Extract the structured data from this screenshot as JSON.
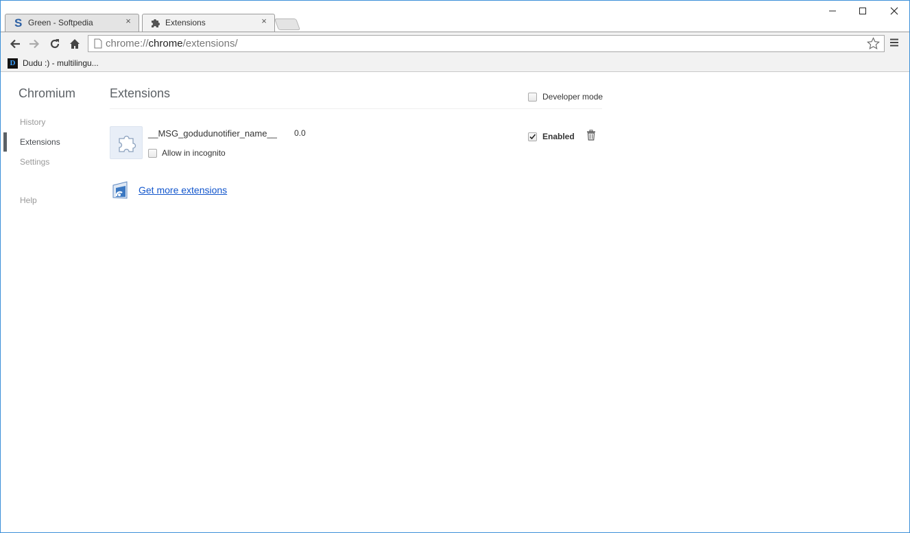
{
  "tabs": [
    {
      "title": "Green - Softpedia",
      "icon": "softpedia-s-icon",
      "active": false
    },
    {
      "title": "Extensions",
      "icon": "puzzle-icon",
      "active": true
    }
  ],
  "omnibox": {
    "scheme": "chrome://",
    "host": "chrome",
    "path": "/extensions/"
  },
  "bookmarks": [
    {
      "icon_letter": "D",
      "label": "Dudu :) - multilingu..."
    }
  ],
  "sidebar": {
    "brand": "Chromium",
    "items": [
      {
        "label": "History",
        "selected": false
      },
      {
        "label": "Extensions",
        "selected": true
      },
      {
        "label": "Settings",
        "selected": false
      },
      {
        "label": "Help",
        "selected": false
      }
    ]
  },
  "main": {
    "title": "Extensions",
    "developer_mode_label": "Developer mode",
    "developer_mode_checked": false,
    "extensions": [
      {
        "name": "__MSG_godudunotifier_name__",
        "version": "0.0",
        "allow_incognito_label": "Allow in incognito",
        "allow_incognito_checked": false,
        "enabled_label": "Enabled",
        "enabled": true
      }
    ],
    "get_more_label": "Get more extensions"
  },
  "colors": {
    "link": "#1155cc",
    "window_border": "#3a8fd8",
    "sidebar_marker": "#5c6166"
  }
}
